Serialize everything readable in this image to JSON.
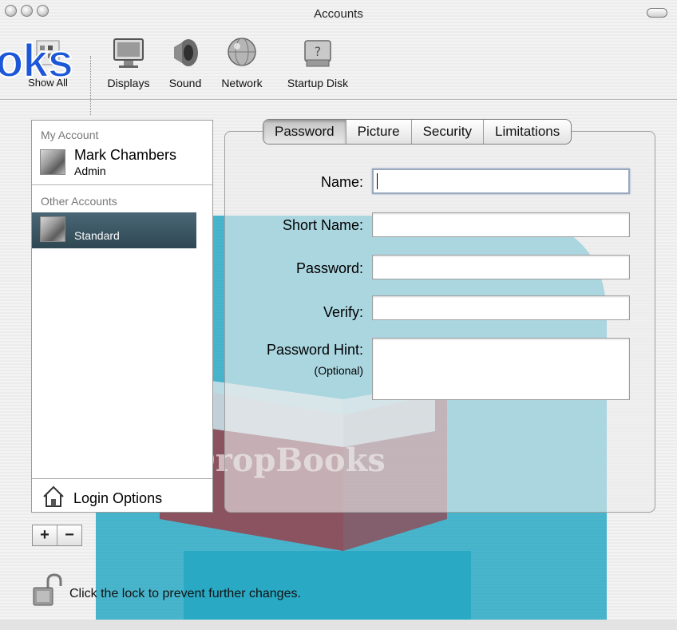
{
  "window": {
    "title": "Accounts"
  },
  "toolbar": {
    "show_all_label": "Show All",
    "items": [
      {
        "label": "Displays",
        "icon": "displays-icon"
      },
      {
        "label": "Sound",
        "icon": "sound-icon"
      },
      {
        "label": "Network",
        "icon": "network-icon"
      },
      {
        "label": "Startup Disk",
        "icon": "startup-disk-icon"
      }
    ]
  },
  "watermark": {
    "text": "oks",
    "logo_text": "DropBooks"
  },
  "sidebar": {
    "my_account_label": "My Account",
    "my_account": {
      "name": "Mark Chambers",
      "role": "Admin"
    },
    "other_accounts_label": "Other Accounts",
    "other_accounts": [
      {
        "name": "",
        "role": "Standard",
        "selected": true
      }
    ],
    "login_options_label": "Login Options"
  },
  "account_buttons": {
    "add": "+",
    "remove": "−"
  },
  "tabs": [
    {
      "label": "Password",
      "active": true
    },
    {
      "label": "Picture",
      "active": false
    },
    {
      "label": "Security",
      "active": false
    },
    {
      "label": "Limitations",
      "active": false
    }
  ],
  "form": {
    "name_label": "Name:",
    "name_value": "",
    "short_name_label": "Short Name:",
    "short_name_value": "",
    "password_label": "Password:",
    "password_value": "",
    "verify_label": "Verify:",
    "verify_value": "",
    "hint_label": "Password Hint:",
    "hint_optional": "(Optional)",
    "hint_value": ""
  },
  "lock": {
    "message": "Click the lock to prevent further changes."
  },
  "colors": {
    "selection": "#3b5664",
    "watermark_blue": "#1b57d8",
    "watermark_teal": "#2aa9c4"
  }
}
